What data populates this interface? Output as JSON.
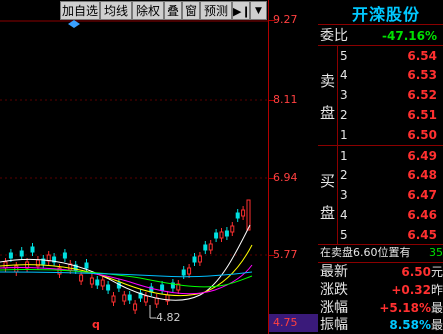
{
  "toolbar": {
    "buttons": [
      "加自选",
      "均线",
      "除权",
      "叠",
      "窗",
      "预测"
    ],
    "nav_icon": "skip-arrow-icon",
    "menu_icon": "dropdown-triangle-icon"
  },
  "axis": {
    "ticks": [
      "9.27",
      "8.11",
      "6.94",
      "5.77",
      "4.75"
    ]
  },
  "chart": {
    "low_label": "4.82",
    "bottom_mark": "q",
    "up_color": "#ff3030",
    "down_color": "#00e0e0",
    "ma_colors": [
      "#ffffff",
      "#ffff00",
      "#ff00ff",
      "#00ff00",
      "#00c0ff"
    ]
  },
  "quote": {
    "stock_name": "开滦股份",
    "weibi_label": "委比",
    "weibi_value": "-47.16%",
    "sell_side_label": [
      "卖",
      "盘"
    ],
    "buy_side_label": [
      "买",
      "盘"
    ],
    "sell": [
      {
        "level": "5",
        "price": "6.54"
      },
      {
        "level": "4",
        "price": "6.53"
      },
      {
        "level": "3",
        "price": "6.52"
      },
      {
        "level": "2",
        "price": "6.51"
      },
      {
        "level": "1",
        "price": "6.50"
      }
    ],
    "buy": [
      {
        "level": "1",
        "price": "6.49"
      },
      {
        "level": "2",
        "price": "6.48"
      },
      {
        "level": "3",
        "price": "6.47"
      },
      {
        "level": "4",
        "price": "6.46"
      },
      {
        "level": "5",
        "price": "6.45"
      }
    ],
    "notice": "在卖盘6.60位置有",
    "notice_tail": "35",
    "stats": [
      {
        "label": "最新",
        "value": "6.50",
        "tail": "元"
      },
      {
        "label": "涨跌",
        "value": "+0.32",
        "tail": "昨"
      },
      {
        "label": "涨幅",
        "value": "+5.18%",
        "tail": "最"
      },
      {
        "label": "振幅",
        "value": "8.58%",
        "tail": "最"
      }
    ],
    "colors": {
      "red": "#ff3030",
      "green": "#00e000",
      "yellow": "#ffff00",
      "cyan": "#00e0e0",
      "name": "#00c8ff"
    }
  }
}
